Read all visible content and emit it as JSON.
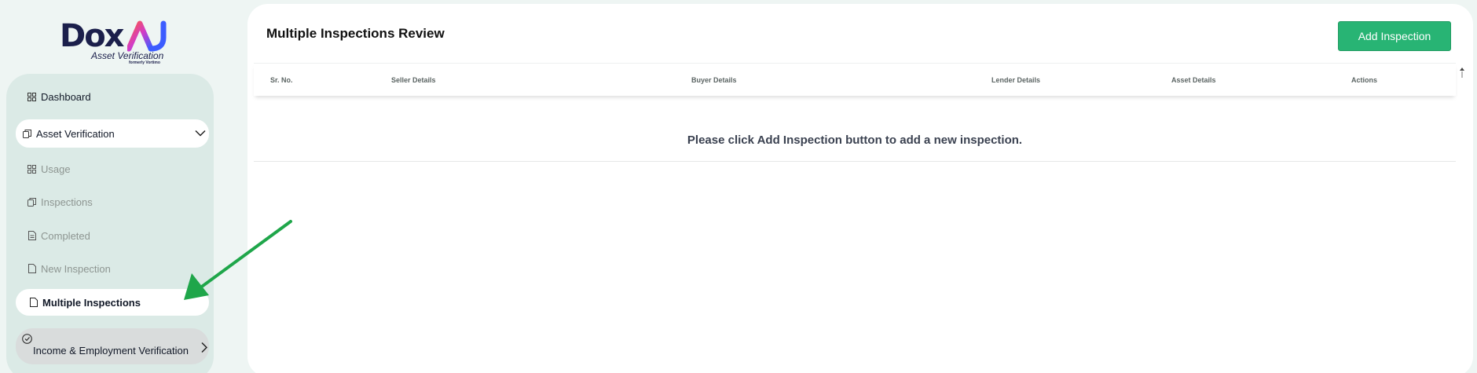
{
  "brand": {
    "name": "Dox",
    "sub": "Asset Verification",
    "sub2": "formerly Vortimo"
  },
  "sidebar": {
    "items": [
      {
        "label": "Dashboard",
        "icon": "grid-icon"
      },
      {
        "label": "Asset Verification",
        "icon": "copy-icon"
      },
      {
        "label": "Usage",
        "icon": "grid-icon"
      },
      {
        "label": "Inspections",
        "icon": "copy-icon"
      },
      {
        "label": "Completed",
        "icon": "file-text-icon"
      },
      {
        "label": "New Inspection",
        "icon": "file-icon"
      },
      {
        "label": "Multiple Inspections",
        "icon": "file-icon"
      },
      {
        "label": "Income & Employment Verification",
        "icon": "check-circle-icon"
      }
    ]
  },
  "main": {
    "title": "Multiple Inspections Review",
    "add_button": "Add Inspection",
    "columns": [
      "Sr. No.",
      "Seller Details",
      "Buyer Details",
      "Lender Details",
      "Asset Details",
      "Actions"
    ],
    "empty_message": "Please click Add Inspection button to add a new inspection."
  },
  "colors": {
    "accent": "#28b474",
    "sidebar_bg": "#dbeae6",
    "page_bg": "#eef5f3",
    "arrow": "#1fa64a"
  }
}
